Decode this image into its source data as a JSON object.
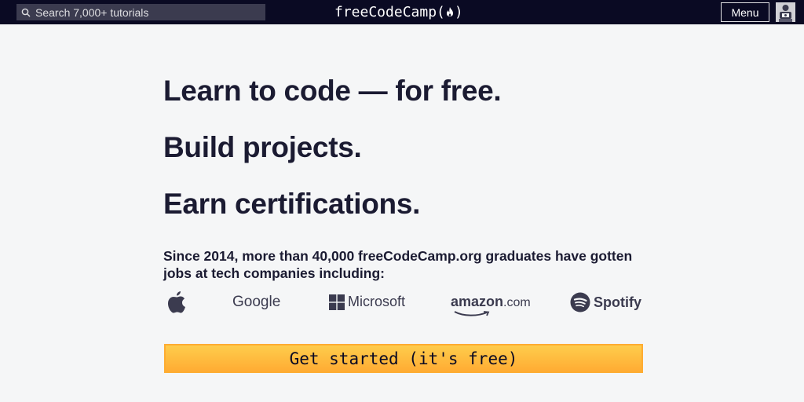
{
  "nav": {
    "search_placeholder": "Search 7,000+ tutorials",
    "logo_text": "freeCodeCamp",
    "logo_open": "(",
    "logo_close": ")",
    "menu_label": "Menu"
  },
  "hero": {
    "line1": "Learn to code — for free.",
    "line2": "Build projects.",
    "line3": "Earn certifications.",
    "intro": "Since 2014, more than 40,000 freeCodeCamp.org graduates have gotten jobs at tech companies including:"
  },
  "companies": {
    "apple": "apple-icon",
    "google": "Google",
    "microsoft": "Microsoft",
    "amazon": "amazon",
    "amazon_suffix": ".com",
    "spotify": "Spotify"
  },
  "cta": {
    "label": "Get started (it's free)"
  },
  "colors": {
    "nav_bg": "#0a0a23",
    "page_bg": "#f5f6f7",
    "text": "#1b1b32",
    "cta_top": "#fecc4c",
    "cta_bottom": "#ffac33"
  }
}
